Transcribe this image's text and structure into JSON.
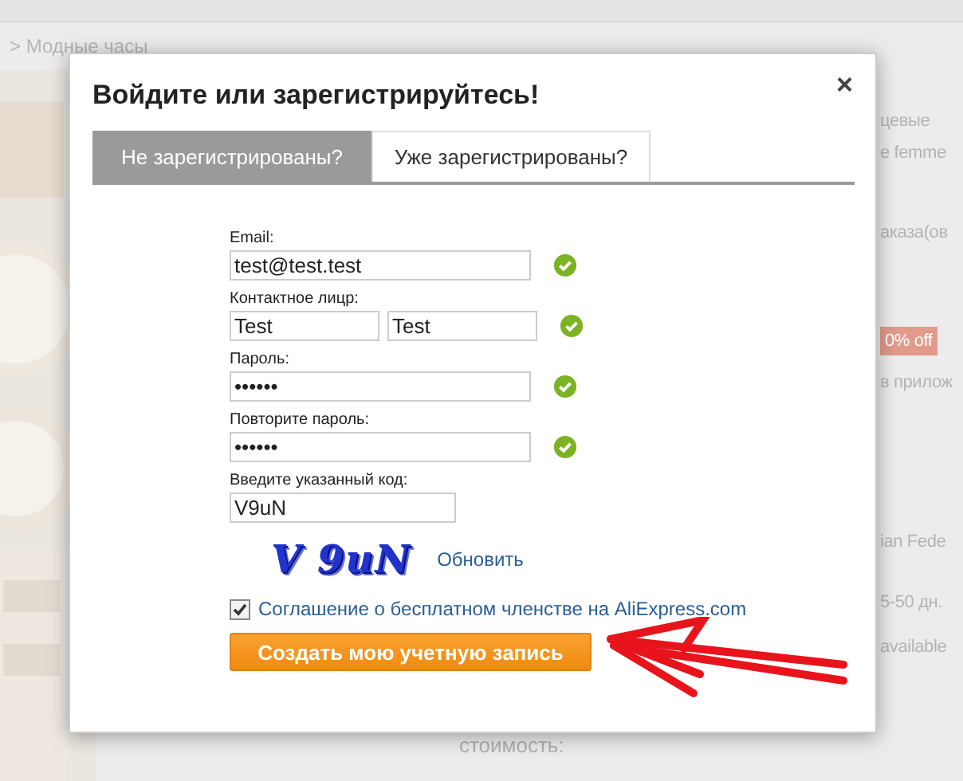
{
  "page": {
    "breadcrumb": "> Модные часы",
    "side_texts": [
      {
        "kind": "text",
        "text": "цевые"
      },
      {
        "kind": "text",
        "text": "e femme"
      },
      {
        "kind": "text",
        "text": "аказа(ов"
      },
      {
        "kind": "badge",
        "text": "0% off"
      },
      {
        "kind": "text",
        "text": "в прилож"
      },
      {
        "kind": "text",
        "text": "ian Fede"
      },
      {
        "kind": "text",
        "text": "5-50 дн."
      },
      {
        "kind": "text",
        "text": "available"
      }
    ],
    "footer_text": "стоимость:"
  },
  "dialog": {
    "title": "Войдите или зарегистрируйтесь!",
    "close": "×",
    "tabs": [
      {
        "label": "Не зарегистрированы?",
        "selected": true
      },
      {
        "label": "Уже зарегистрированы?",
        "selected": false
      }
    ],
    "fields": [
      {
        "kind": "single",
        "label": "Email:",
        "values": [
          "test@test.test"
        ],
        "valid": true
      },
      {
        "kind": "pair",
        "label": "Контактное лицр:",
        "values": [
          "Test",
          "Test"
        ],
        "valid": true
      },
      {
        "kind": "single",
        "label": "Пароль:",
        "values": [
          "••••••"
        ],
        "valid": true
      },
      {
        "kind": "single",
        "label": "Повторите пароль:",
        "values": [
          "••••••"
        ],
        "valid": true
      }
    ],
    "captcha": {
      "label": "Введите указанный код:",
      "value": "V9uN",
      "image_text": "V 9uN",
      "refresh": "Обновить"
    },
    "agreement": {
      "checked": true,
      "link": "Соглашение о бесплатном членстве на AliExpress.com"
    },
    "submit": "Создать мою учетную запись"
  }
}
